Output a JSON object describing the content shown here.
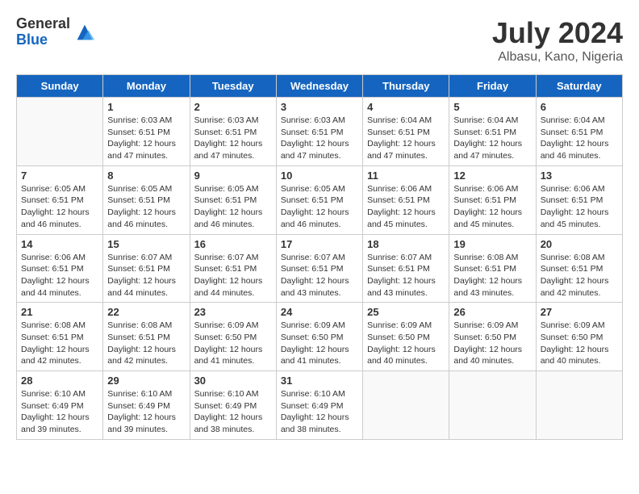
{
  "logo": {
    "general": "General",
    "blue": "Blue"
  },
  "title": "July 2024",
  "location": "Albasu, Kano, Nigeria",
  "days_of_week": [
    "Sunday",
    "Monday",
    "Tuesday",
    "Wednesday",
    "Thursday",
    "Friday",
    "Saturday"
  ],
  "weeks": [
    [
      {
        "day": "",
        "info": ""
      },
      {
        "day": "1",
        "info": "Sunrise: 6:03 AM\nSunset: 6:51 PM\nDaylight: 12 hours\nand 47 minutes."
      },
      {
        "day": "2",
        "info": "Sunrise: 6:03 AM\nSunset: 6:51 PM\nDaylight: 12 hours\nand 47 minutes."
      },
      {
        "day": "3",
        "info": "Sunrise: 6:03 AM\nSunset: 6:51 PM\nDaylight: 12 hours\nand 47 minutes."
      },
      {
        "day": "4",
        "info": "Sunrise: 6:04 AM\nSunset: 6:51 PM\nDaylight: 12 hours\nand 47 minutes."
      },
      {
        "day": "5",
        "info": "Sunrise: 6:04 AM\nSunset: 6:51 PM\nDaylight: 12 hours\nand 47 minutes."
      },
      {
        "day": "6",
        "info": "Sunrise: 6:04 AM\nSunset: 6:51 PM\nDaylight: 12 hours\nand 46 minutes."
      }
    ],
    [
      {
        "day": "7",
        "info": "Sunrise: 6:05 AM\nSunset: 6:51 PM\nDaylight: 12 hours\nand 46 minutes."
      },
      {
        "day": "8",
        "info": "Sunrise: 6:05 AM\nSunset: 6:51 PM\nDaylight: 12 hours\nand 46 minutes."
      },
      {
        "day": "9",
        "info": "Sunrise: 6:05 AM\nSunset: 6:51 PM\nDaylight: 12 hours\nand 46 minutes."
      },
      {
        "day": "10",
        "info": "Sunrise: 6:05 AM\nSunset: 6:51 PM\nDaylight: 12 hours\nand 46 minutes."
      },
      {
        "day": "11",
        "info": "Sunrise: 6:06 AM\nSunset: 6:51 PM\nDaylight: 12 hours\nand 45 minutes."
      },
      {
        "day": "12",
        "info": "Sunrise: 6:06 AM\nSunset: 6:51 PM\nDaylight: 12 hours\nand 45 minutes."
      },
      {
        "day": "13",
        "info": "Sunrise: 6:06 AM\nSunset: 6:51 PM\nDaylight: 12 hours\nand 45 minutes."
      }
    ],
    [
      {
        "day": "14",
        "info": "Sunrise: 6:06 AM\nSunset: 6:51 PM\nDaylight: 12 hours\nand 44 minutes."
      },
      {
        "day": "15",
        "info": "Sunrise: 6:07 AM\nSunset: 6:51 PM\nDaylight: 12 hours\nand 44 minutes."
      },
      {
        "day": "16",
        "info": "Sunrise: 6:07 AM\nSunset: 6:51 PM\nDaylight: 12 hours\nand 44 minutes."
      },
      {
        "day": "17",
        "info": "Sunrise: 6:07 AM\nSunset: 6:51 PM\nDaylight: 12 hours\nand 43 minutes."
      },
      {
        "day": "18",
        "info": "Sunrise: 6:07 AM\nSunset: 6:51 PM\nDaylight: 12 hours\nand 43 minutes."
      },
      {
        "day": "19",
        "info": "Sunrise: 6:08 AM\nSunset: 6:51 PM\nDaylight: 12 hours\nand 43 minutes."
      },
      {
        "day": "20",
        "info": "Sunrise: 6:08 AM\nSunset: 6:51 PM\nDaylight: 12 hours\nand 42 minutes."
      }
    ],
    [
      {
        "day": "21",
        "info": "Sunrise: 6:08 AM\nSunset: 6:51 PM\nDaylight: 12 hours\nand 42 minutes."
      },
      {
        "day": "22",
        "info": "Sunrise: 6:08 AM\nSunset: 6:51 PM\nDaylight: 12 hours\nand 42 minutes."
      },
      {
        "day": "23",
        "info": "Sunrise: 6:09 AM\nSunset: 6:50 PM\nDaylight: 12 hours\nand 41 minutes."
      },
      {
        "day": "24",
        "info": "Sunrise: 6:09 AM\nSunset: 6:50 PM\nDaylight: 12 hours\nand 41 minutes."
      },
      {
        "day": "25",
        "info": "Sunrise: 6:09 AM\nSunset: 6:50 PM\nDaylight: 12 hours\nand 40 minutes."
      },
      {
        "day": "26",
        "info": "Sunrise: 6:09 AM\nSunset: 6:50 PM\nDaylight: 12 hours\nand 40 minutes."
      },
      {
        "day": "27",
        "info": "Sunrise: 6:09 AM\nSunset: 6:50 PM\nDaylight: 12 hours\nand 40 minutes."
      }
    ],
    [
      {
        "day": "28",
        "info": "Sunrise: 6:10 AM\nSunset: 6:49 PM\nDaylight: 12 hours\nand 39 minutes."
      },
      {
        "day": "29",
        "info": "Sunrise: 6:10 AM\nSunset: 6:49 PM\nDaylight: 12 hours\nand 39 minutes."
      },
      {
        "day": "30",
        "info": "Sunrise: 6:10 AM\nSunset: 6:49 PM\nDaylight: 12 hours\nand 38 minutes."
      },
      {
        "day": "31",
        "info": "Sunrise: 6:10 AM\nSunset: 6:49 PM\nDaylight: 12 hours\nand 38 minutes."
      },
      {
        "day": "",
        "info": ""
      },
      {
        "day": "",
        "info": ""
      },
      {
        "day": "",
        "info": ""
      }
    ]
  ]
}
